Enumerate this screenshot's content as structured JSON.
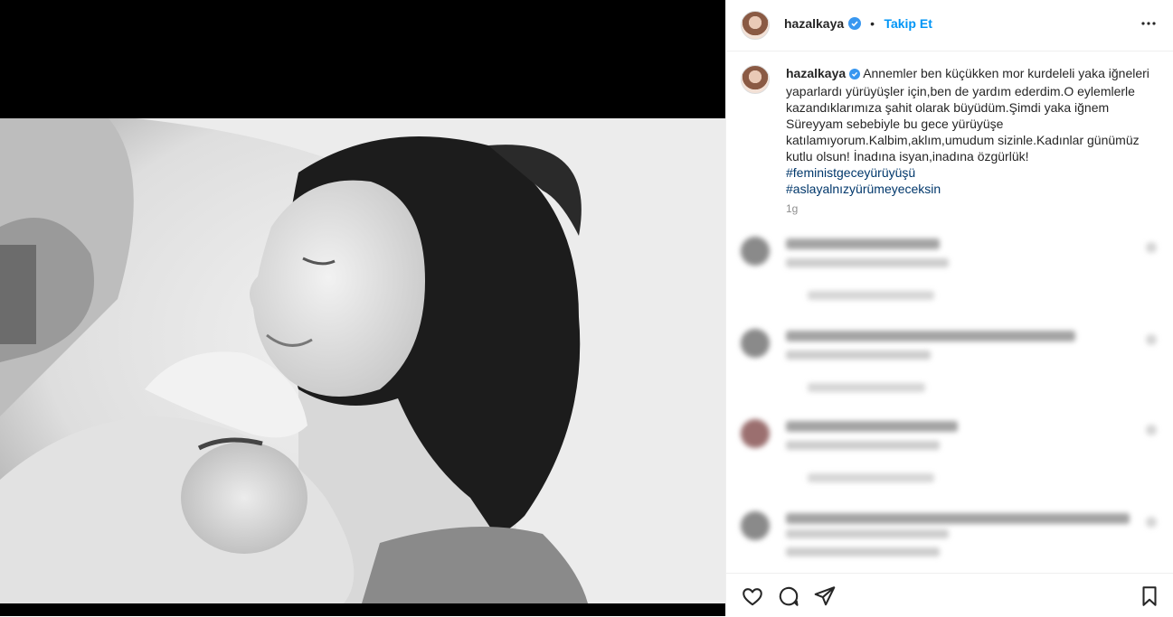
{
  "post": {
    "username": "hazalkaya",
    "dot": "•",
    "follow_label": "Takip Et",
    "caption_text": "Annemler ben küçükken mor kurdeleli yaka iğneleri yaparlardı yürüyüşler için,ben de yardım ederdim.O eylemlerle kazandıklarımıza şahit olarak büyüdüm.Şimdi yaka iğnem Süreyyam sebebiyle bu gece yürüyüşe katılamıyorum.Kalbim,aklım,umudum sizinle.Kadınlar günümüz kutlu olsun! İnadına isyan,inadına özgürlük!",
    "hashtags": [
      "#feministgeceyürüyüşü",
      "#aslayalnızyürümeyeceksin"
    ],
    "age": "1g"
  },
  "colors": {
    "accent": "#0095f6",
    "hashtag": "#00376b",
    "muted": "#8e8e8e",
    "verified": "#3897f0"
  },
  "icons": {
    "verified": "verified-badge-icon",
    "more": "more-options-icon",
    "like": "heart-icon",
    "comment": "comment-icon",
    "share": "share-icon",
    "save": "bookmark-icon"
  }
}
